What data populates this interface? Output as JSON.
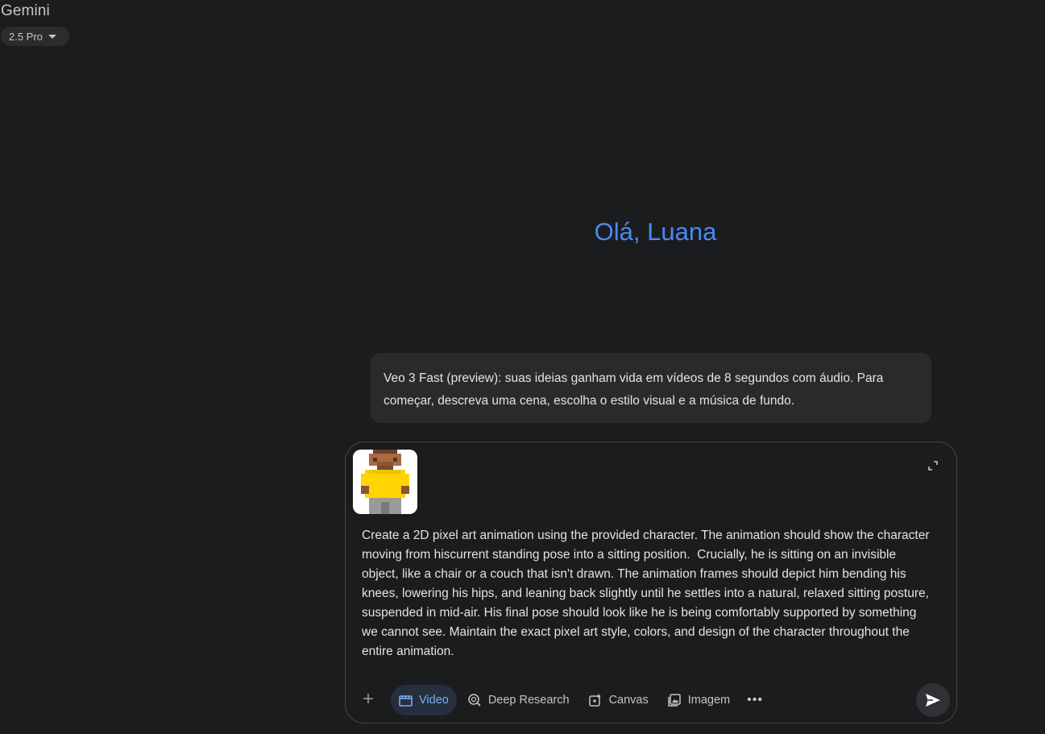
{
  "app": {
    "title": "Gemini",
    "model": "2.5 Pro"
  },
  "greeting": "Olá, Luana",
  "info_card": {
    "text": "Veo 3 Fast (preview): suas ideias ganham vida em vídeos de 8 segundos com áudio. Para começar, descreva uma cena, escolha o estilo visual e a música de fundo."
  },
  "composer": {
    "prompt": "Create a 2D pixel art animation using the provided character. The animation should show the character moving from hiscurrent standing pose into a sitting position.  Crucially, he is sitting on an invisible object, like a chair or a couch that isn't drawn. The animation frames should depict him bending his knees, lowering his hips, and leaning back slightly until he settles into a natural, relaxed sitting posture, suspended in mid-air. His final pose should look like he is being comfortably supported by something we cannot see. Maintain the exact pixel art style, colors, and design of the character throughout the entire animation.",
    "attachment_icon": "pixel-character-thumbnail",
    "tools": [
      {
        "label": "Video",
        "icon": "video-icon",
        "active": true
      },
      {
        "label": "Deep Research",
        "icon": "deep-research-icon",
        "active": false
      },
      {
        "label": "Canvas",
        "icon": "canvas-icon",
        "active": false
      },
      {
        "label": "Imagem",
        "icon": "image-icon",
        "active": false
      }
    ],
    "more_label": "•••"
  },
  "colors": {
    "accent": "#4a8af4",
    "background": "#1b1c1d",
    "card": "#282a2c"
  }
}
